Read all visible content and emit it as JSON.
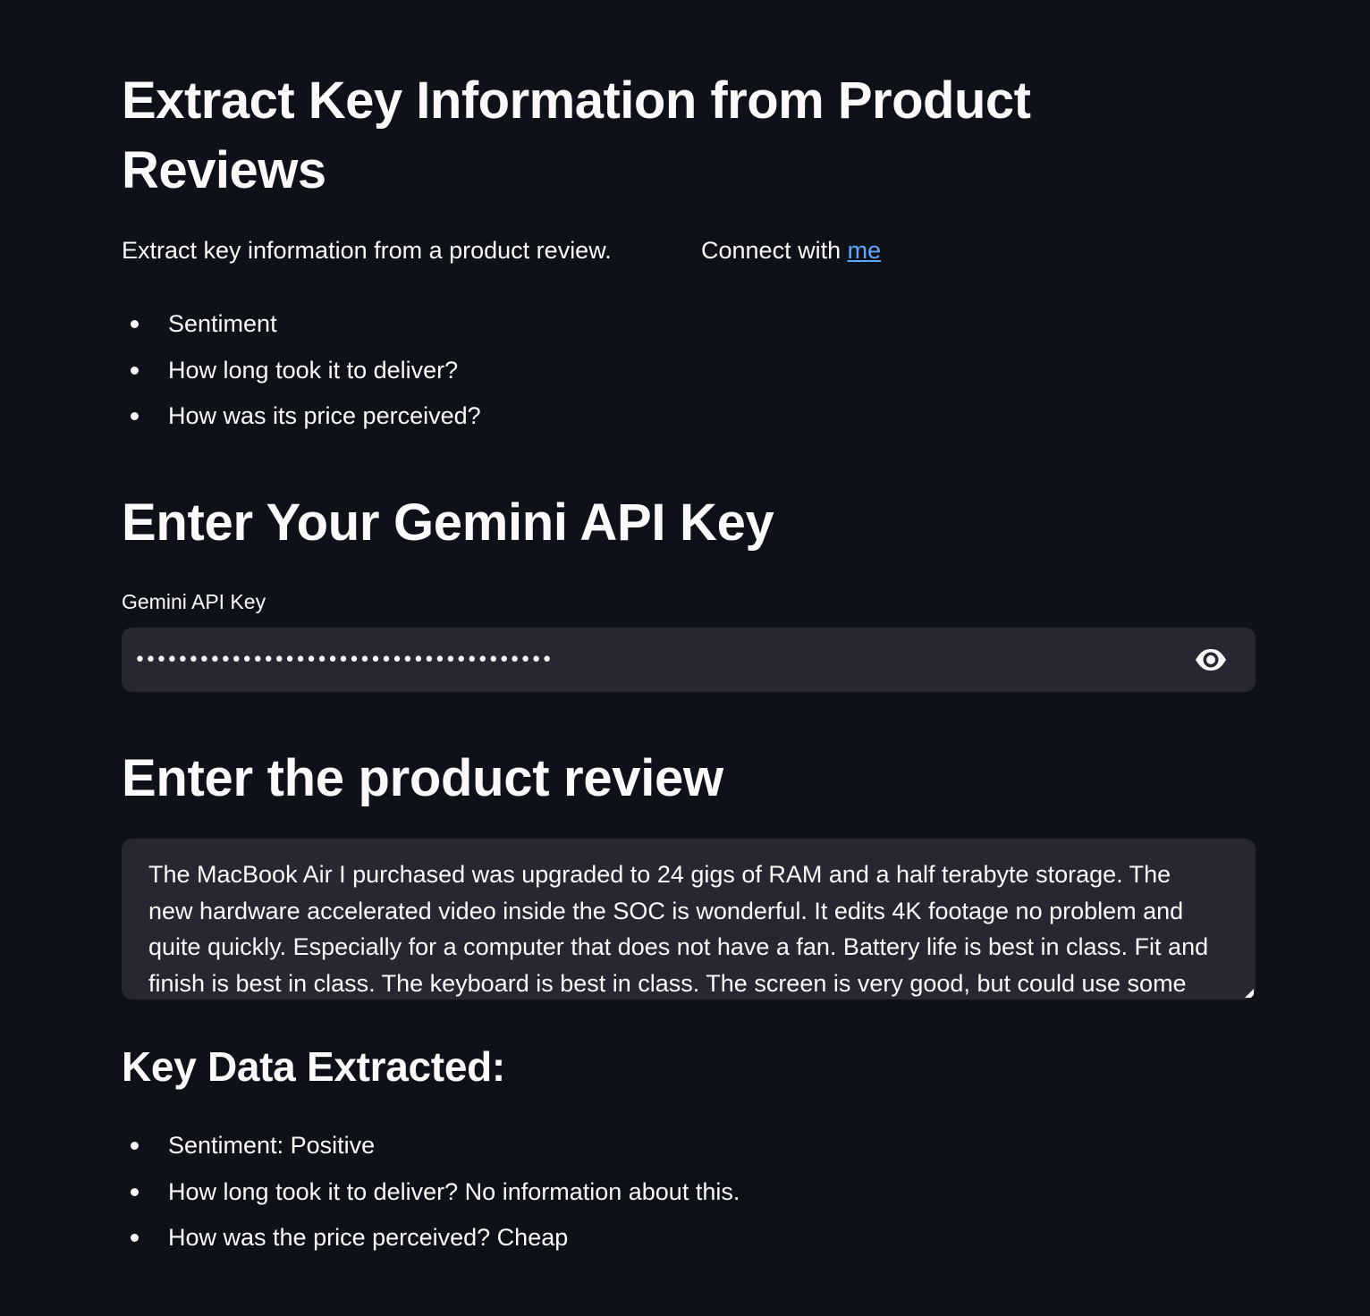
{
  "header": {
    "title": "Extract Key Information from Product Reviews"
  },
  "intro": {
    "description": "Extract key information from a product review.",
    "connect_prefix": "Connect with ",
    "connect_link": "me"
  },
  "features": [
    "Sentiment",
    "How long took it to deliver?",
    "How was its price perceived?"
  ],
  "api_section": {
    "heading": "Enter Your Gemini API Key",
    "label": "Gemini API Key",
    "value": "•••••••••••••••••••••••••••••••••••••••",
    "toggle_icon": "eye-icon"
  },
  "review_section": {
    "heading": "Enter the product review",
    "text": "The MacBook Air I purchased was upgraded to 24 gigs of RAM and a half terabyte storage. The new hardware accelerated video inside the SOC is wonderful. It edits 4K footage no problem and quite quickly. Especially for a computer that does not have a fan. Battery life is best in class. Fit and finish is best in class. The keyboard is best in class. The screen is very good, but could use some"
  },
  "results": {
    "heading": "Key Data Extracted:",
    "items": [
      "Sentiment: Positive",
      "How long took it to deliver? No information about this.",
      "How was the price perceived? Cheap"
    ]
  },
  "colors": {
    "background": "#0e1117",
    "input_background": "#262730",
    "text": "#fafafa",
    "link": "#5da7ff"
  }
}
